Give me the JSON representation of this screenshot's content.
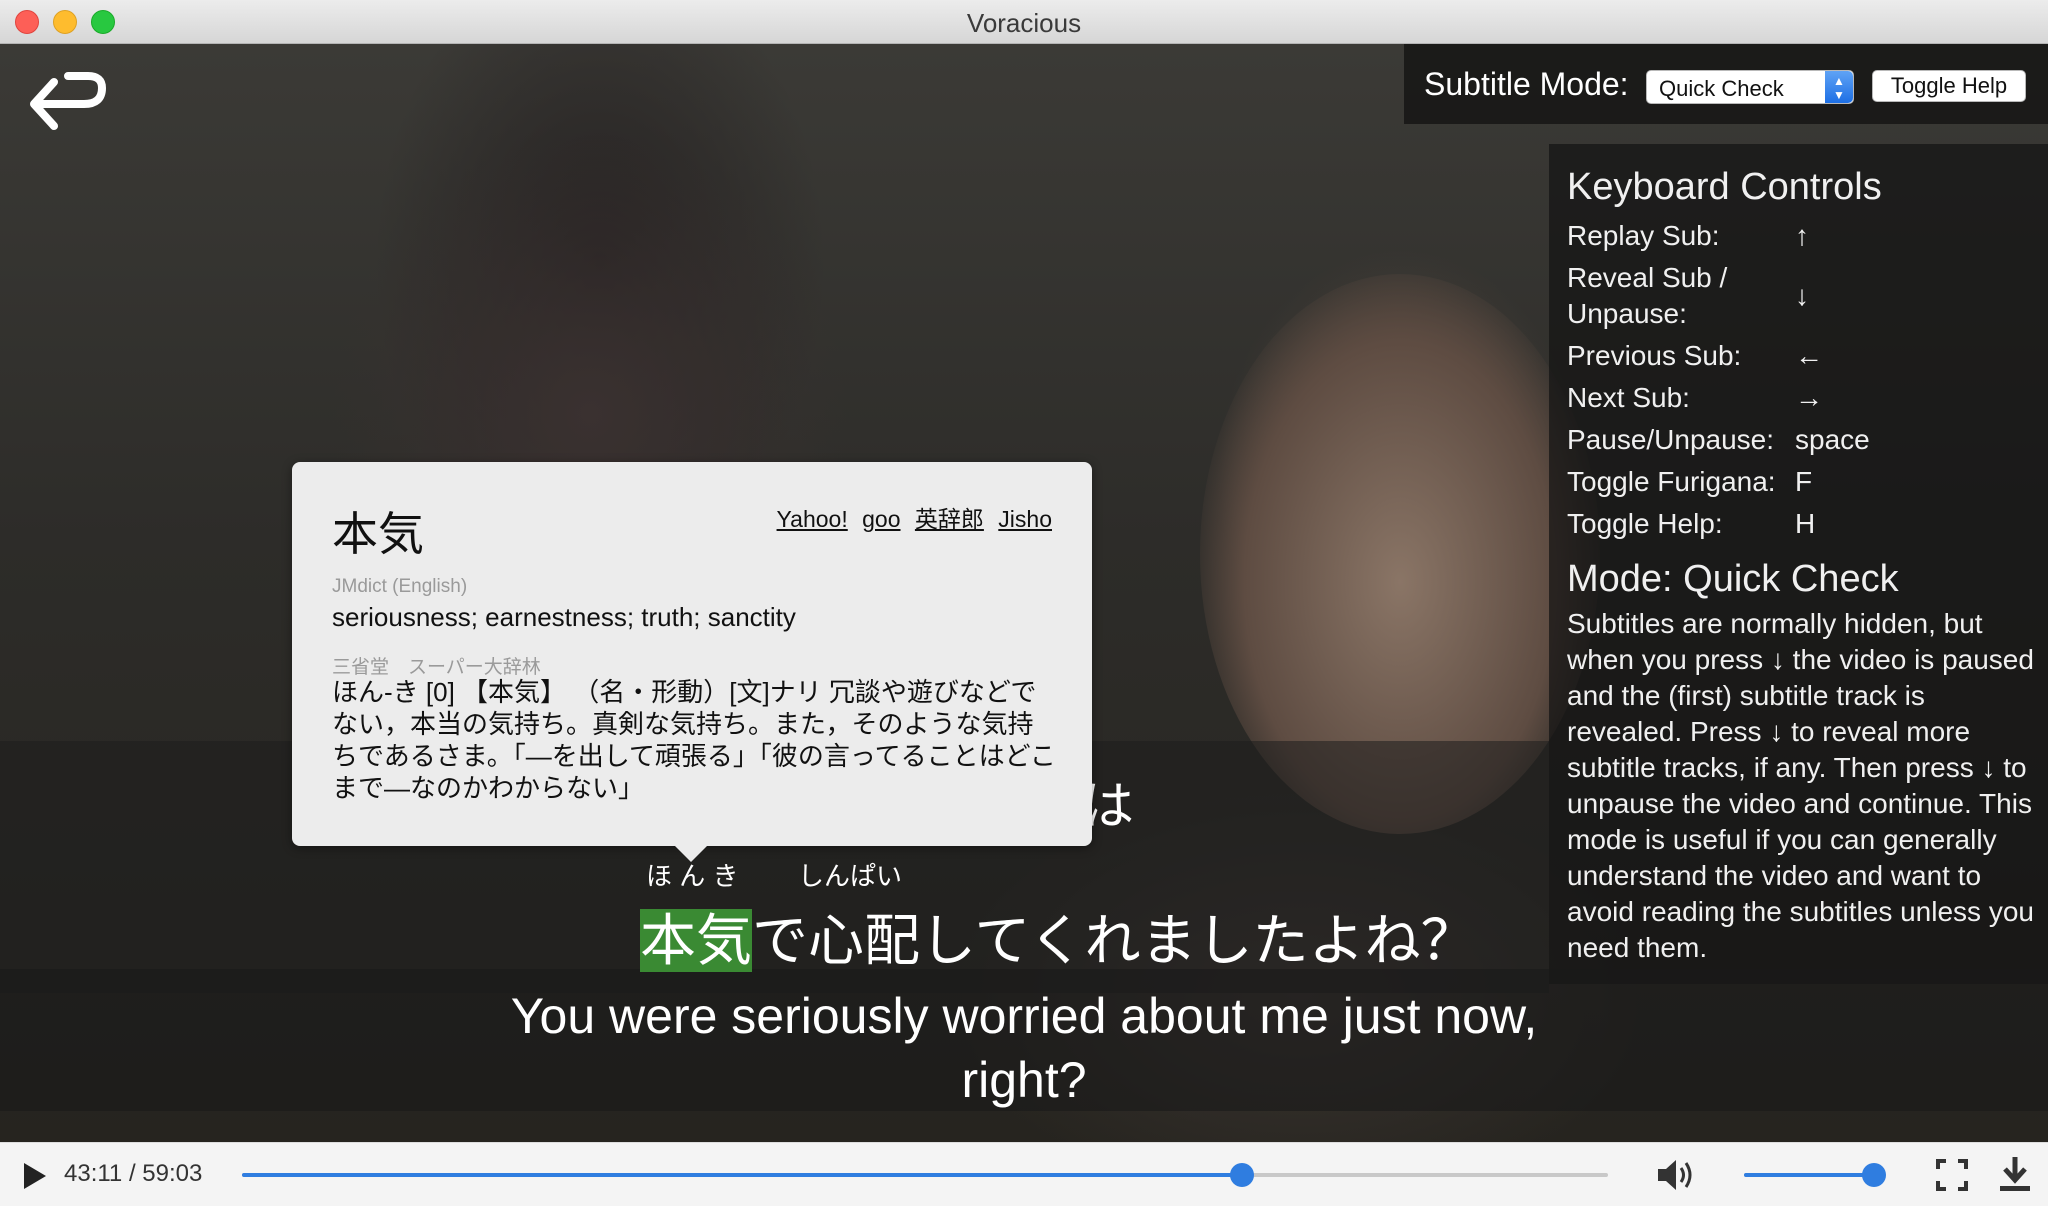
{
  "window": {
    "title": "Voracious"
  },
  "toolbar": {
    "subtitle_mode_label": "Subtitle Mode:",
    "subtitle_mode_value": "Quick Check",
    "toggle_help_label": "Toggle Help"
  },
  "help": {
    "title": "Keyboard Controls",
    "keys": [
      {
        "label": "Replay Sub:",
        "key": "↑"
      },
      {
        "label": "Reveal Sub /",
        "label2": "Unpause:",
        "key": "↓"
      },
      {
        "label": "Previous Sub:",
        "key": "←"
      },
      {
        "label": "Next Sub:",
        "key": "→"
      },
      {
        "label": "Pause/Unpause:",
        "key": "space"
      },
      {
        "label": "Toggle Furigana:",
        "key": "F"
      },
      {
        "label": "Toggle Help:",
        "key": "H"
      }
    ],
    "mode_title": "Mode: Quick Check",
    "mode_description": "Subtitles are normally hidden, but when you press ↓ the video is paused and the (first) subtitle track is revealed. Press ↓ to reveal more subtitle tracks, if any. Then press ↓ to unpause the video and continue. This mode is useful if you can generally understand the video and want to avoid reading the subtitles unless you need them."
  },
  "popup": {
    "word": "本気",
    "links": [
      "Yahoo!",
      "goo",
      "英辞郎",
      "Jisho"
    ],
    "source1": "JMdict (English)",
    "definition1": "seriousness; earnestness; truth; sanctity",
    "source2": "三省堂　スーパー大辞林",
    "definition2": "ほん-き [0] 【本気】 （名・形動）[文]ナリ 冗談や遊びなどでない，本当の気持ち。真剣な気持ち。また，そのような気持ちであるさま。「—を出して頑張る」「彼の言ってることはどこまで—なのかわからない」"
  },
  "subtitles": {
    "jp_line1": "さっきは",
    "jp_ruby1": "ほ ん き",
    "jp_ruby2": "しんぱい",
    "jp_highlight": "本気",
    "jp_rest": "で心配してくれましたよね？",
    "en_line1": "You were seriously worried about me just now,",
    "en_line2": "right?"
  },
  "player": {
    "time": "43:11 / 59:03",
    "progress_fraction": 0.732,
    "volume_fraction": 0.93
  }
}
